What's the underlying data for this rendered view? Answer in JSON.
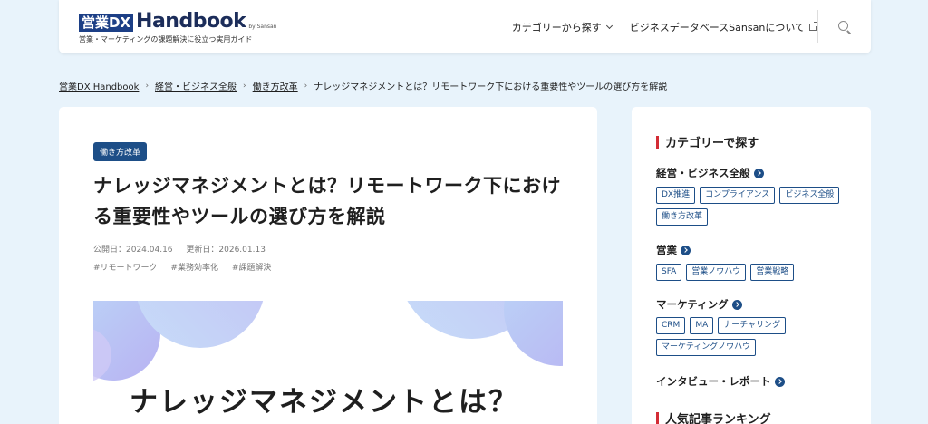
{
  "header": {
    "logo_box": "営業DX",
    "logo_main": "Handbook",
    "logo_by": "by Sansan",
    "logo_tagline": "営業・マーケティングの課題解決に役立つ実用ガイド",
    "nav": [
      {
        "label": "カテゴリーから探す",
        "icon": "chevron-down-icon"
      },
      {
        "label": "ビジネスデータベースSansanについて",
        "icon": "external-link-icon"
      }
    ],
    "search_icon": "search-icon"
  },
  "breadcrumb": {
    "items": [
      "営業DX Handbook",
      "経営・ビジネス全般",
      "働き方改革"
    ],
    "current": "ナレッジマネジメントとは？リモートワーク下における重要性やツールの選び方を解説"
  },
  "article": {
    "category": "働き方改革",
    "title": "ナレッジマネジメントとは？リモートワーク下における重要性やツールの選び方を解説",
    "published": "公開日：2024.04.16",
    "updated": "更新日：2026.01.13",
    "tags": [
      "#リモートワーク",
      "#業務効率化",
      "#課題解決"
    ],
    "hero_text": "ナレッジマネジメントとは？"
  },
  "sidebar": {
    "heading": "カテゴリーで探す",
    "categories": [
      {
        "label": "経営・ビジネス全般",
        "chips": [
          "DX推進",
          "コンプライアンス",
          "ビジネス全般",
          "働き方改革"
        ]
      },
      {
        "label": "営業",
        "chips": [
          "SFA",
          "営業ノウハウ",
          "営業戦略"
        ]
      },
      {
        "label": "マーケティング",
        "chips": [
          "CRM",
          "MA",
          "ナーチャリング",
          "マーケティングノウハウ"
        ]
      },
      {
        "label": "インタビュー・レポート",
        "chips": []
      }
    ],
    "ranking_heading": "人気記事ランキング"
  },
  "colors": {
    "brand_navy": "#1c3f86",
    "accent_blue": "#1d4e87",
    "accent_red": "#d32c35",
    "page_bg": "#e8f3fb"
  }
}
